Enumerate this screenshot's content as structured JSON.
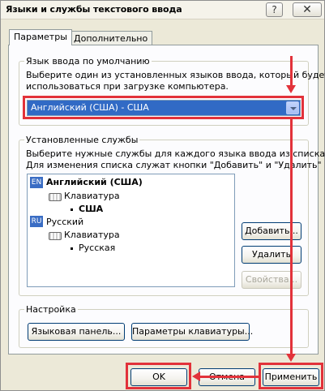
{
  "window": {
    "title": "Языки и службы текстового ввода",
    "help_glyph": "?",
    "close_glyph": "✕"
  },
  "tabs": [
    {
      "label": "Параметры",
      "active": true
    },
    {
      "label": "Дополнительно",
      "active": false
    }
  ],
  "default_language": {
    "group_title": "Язык ввода по умолчанию",
    "description_line1": "Выберите один из установленных языков ввода, который будет",
    "description_line2": "использоваться при загрузке компьютера.",
    "selected_value": "Английский (США) - США"
  },
  "installed_services": {
    "group_title": "Установленные службы",
    "description_line1": "Выберите нужные службы для каждого языка ввода из списка.",
    "description_line2": "Для изменения списка служат кнопки \"Добавить\" и \"Удалить\"",
    "languages": [
      {
        "badge": "EN",
        "name": "Английский (США)",
        "category": "Клавиатура",
        "layout": "США"
      },
      {
        "badge": "RU",
        "name": "Русский",
        "category": "Клавиатура",
        "layout": "Русская"
      }
    ],
    "buttons": {
      "add": "Добавить...",
      "remove": "Удалить",
      "properties": "Свойства..."
    }
  },
  "settings": {
    "group_title": "Настройка",
    "language_bar_button": "Языковая панель...",
    "keyboard_settings_button": "Параметры клавиатуры..."
  },
  "footer": {
    "ok": "OK",
    "cancel": "Отмена",
    "apply": "Применить"
  },
  "colors": {
    "annotation_red": "#e2323a",
    "selection_blue": "#316ac5",
    "dialog_bg": "#ece9d8"
  }
}
